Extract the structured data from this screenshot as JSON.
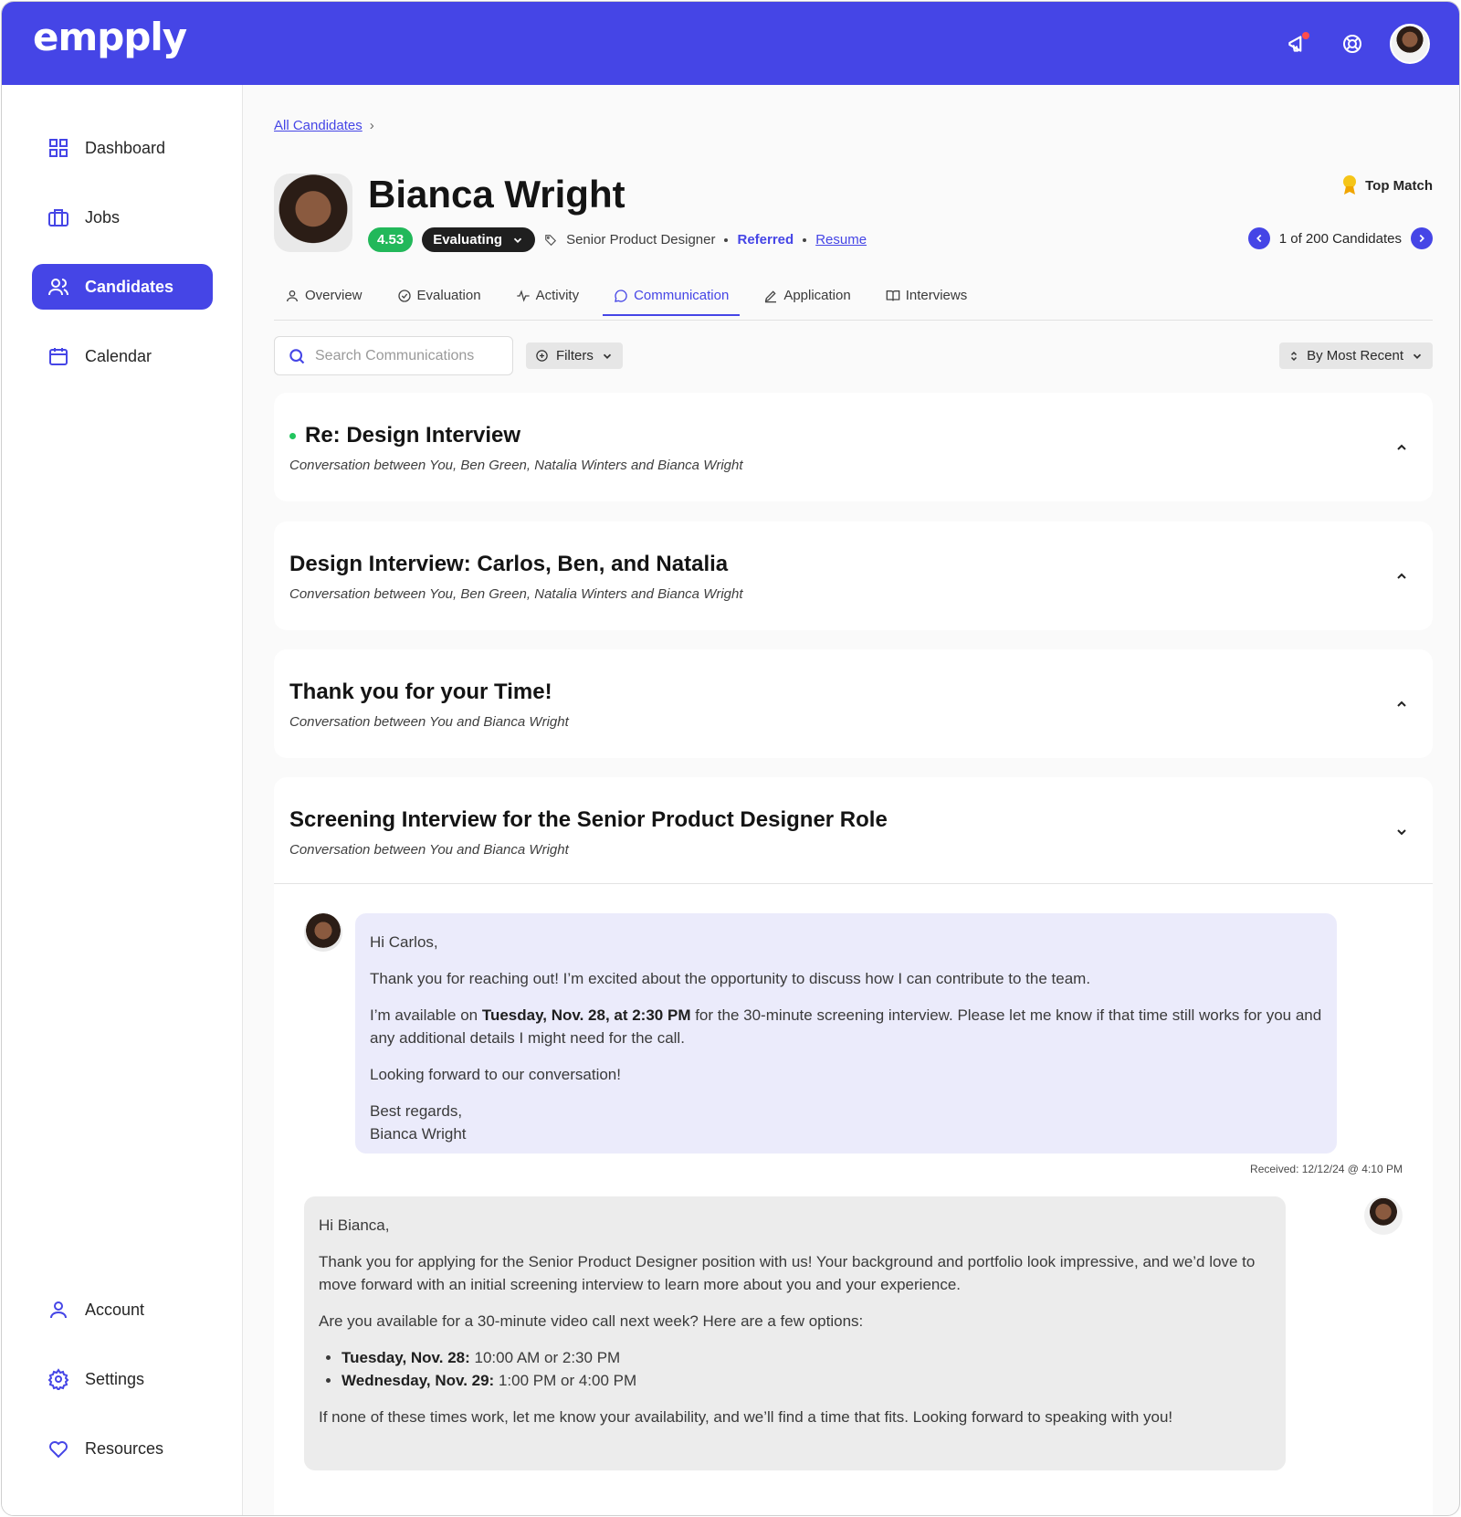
{
  "header": {
    "logo": "empply",
    "icons": [
      "megaphone-icon",
      "help-icon",
      "user-avatar"
    ]
  },
  "sidebar": {
    "items": [
      {
        "label": "Dashboard",
        "icon": "dashboard-icon"
      },
      {
        "label": "Jobs",
        "icon": "briefcase-icon"
      },
      {
        "label": "Candidates",
        "icon": "users-icon",
        "active": true
      },
      {
        "label": "Calendar",
        "icon": "calendar-icon"
      }
    ],
    "bottom_items": [
      {
        "label": "Account",
        "icon": "user-icon"
      },
      {
        "label": "Settings",
        "icon": "gear-icon"
      },
      {
        "label": "Resources",
        "icon": "heart-icon"
      }
    ]
  },
  "breadcrumb": {
    "link": "All Candidates",
    "separator": "›"
  },
  "candidate": {
    "name": "Bianca Wright",
    "score": "4.53",
    "status": "Evaluating",
    "role": "Senior Product Designer",
    "source": "Referred",
    "resume": "Resume",
    "badge": "Top Match",
    "pager": "1 of 200 Candidates"
  },
  "tabs": [
    {
      "label": "Overview",
      "icon": "person-icon"
    },
    {
      "label": "Evaluation",
      "icon": "check-circle-icon"
    },
    {
      "label": "Activity",
      "icon": "activity-icon"
    },
    {
      "label": "Communication",
      "icon": "chat-icon",
      "active": true
    },
    {
      "label": "Application",
      "icon": "pencil-icon"
    },
    {
      "label": "Interviews",
      "icon": "book-icon"
    }
  ],
  "toolbar": {
    "search_placeholder": "Search Communications",
    "filters": "Filters",
    "sort": "By Most Recent"
  },
  "conversations": [
    {
      "title": "Re: Design Interview",
      "subtitle": "Conversation between You, Ben Green, Natalia Winters and Bianca Wright",
      "unread": true,
      "expanded": false
    },
    {
      "title": "Design Interview: Carlos, Ben, and Natalia",
      "subtitle": "Conversation between You, Ben Green, Natalia Winters and Bianca Wright",
      "expanded": false
    },
    {
      "title": "Thank you for your Time!",
      "subtitle": "Conversation between You and Bianca Wright",
      "expanded": false
    },
    {
      "title": "Screening Interview for the Senior Product Designer Role",
      "subtitle": "Conversation between You and Bianca Wright",
      "expanded": true
    }
  ],
  "messages": {
    "incoming": {
      "greeting": "Hi Carlos,",
      "p1": "Thank you for reaching out! I’m excited about the opportunity to discuss how I can contribute to the team.",
      "p2_before": "I’m available on ",
      "p2_bold": "Tuesday, Nov. 28, at 2:30 PM",
      "p2_after": " for the 30-minute screening interview. Please let me know if that time still works for you and any additional details I might need for the call.",
      "p3": "Looking forward to our conversation!",
      "signoff": "Best regards,",
      "signature": "Bianca Wright",
      "received": "Received: 12/12/24 @ 4:10 PM"
    },
    "outgoing": {
      "greeting": "Hi Bianca,",
      "p1": "Thank you for applying for the Senior Product Designer position with us! Your background and portfolio look impressive, and we’d love to move forward with an initial screening interview to learn more about you and your experience.",
      "p2": "Are you available for a 30-minute video call next week? Here are a few options:",
      "options": [
        {
          "day": "Tuesday, Nov. 28:",
          "times": " 10:00 AM or 2:30 PM"
        },
        {
          "day": "Wednesday, Nov. 29:",
          "times": " 1:00 PM or 4:00 PM"
        }
      ],
      "p3": "If none of these times work, let me know your availability, and we’ll find a time that fits. Looking forward to speaking with you!"
    }
  },
  "colors": {
    "brand": "#4545e6",
    "success": "#22b85a",
    "bubble_in": "#ebebfb",
    "bubble_out": "#ececec"
  }
}
